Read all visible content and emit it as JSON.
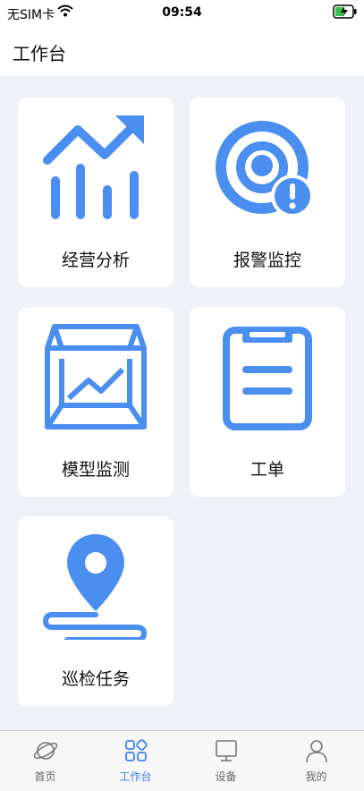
{
  "status": {
    "carrier": "无SIM卡",
    "time": "09:54"
  },
  "header": {
    "title": "工作台"
  },
  "tiles": [
    {
      "label": "经营分析",
      "icon": "chart-trend-icon"
    },
    {
      "label": "报警监控",
      "icon": "alarm-monitor-icon"
    },
    {
      "label": "模型监测",
      "icon": "model-box-icon"
    },
    {
      "label": "工单",
      "icon": "clipboard-icon"
    },
    {
      "label": "巡检任务",
      "icon": "location-route-icon"
    }
  ],
  "tabbar": {
    "items": [
      {
        "label": "首页",
        "icon": "planet-icon"
      },
      {
        "label": "工作台",
        "icon": "grid-icon",
        "active": true
      },
      {
        "label": "设备",
        "icon": "monitor-icon"
      },
      {
        "label": "我的",
        "icon": "user-icon"
      }
    ]
  },
  "colors": {
    "accent": "#4a8ef0",
    "active_tab": "#3b82f0",
    "background": "#eef1f5"
  }
}
